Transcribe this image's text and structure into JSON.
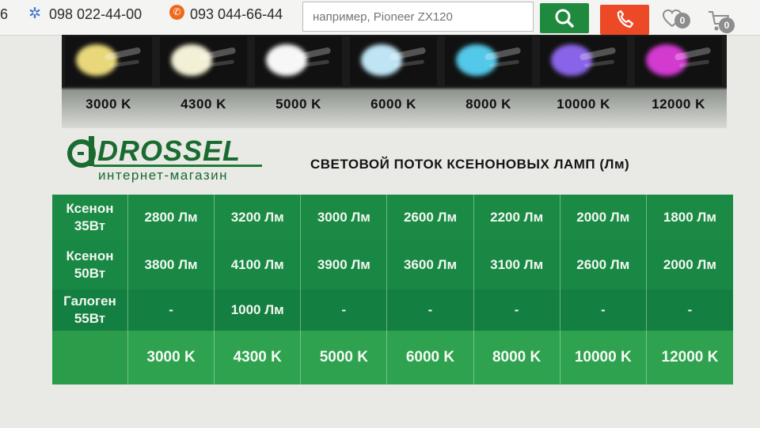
{
  "header": {
    "edge_text": "6",
    "phone_primary": "098 022-44-00",
    "phone_secondary": "093 044-66-44",
    "search_placeholder": "например, Pioneer ZX120",
    "favorites_count": "0",
    "cart_count": "0",
    "colors": {
      "search_button": "#1f8a3d",
      "call_button": "#ec4a27",
      "phone_icon": "#ee6a1b",
      "star_icon": "#3a73c8"
    },
    "icons": [
      "star-icon",
      "phone-icon",
      "search-icon",
      "phone-call-icon",
      "heart-icon",
      "cart-icon"
    ]
  },
  "lamp_samples": [
    {
      "label": "3000 K",
      "glow": "#e8d87a"
    },
    {
      "label": "4300 K",
      "glow": "#f4f0d6"
    },
    {
      "label": "5000 K",
      "glow": "#f7f7f7"
    },
    {
      "label": "6000 K",
      "glow": "#bfe4f4"
    },
    {
      "label": "8000 K",
      "glow": "#53c8e8"
    },
    {
      "label": "10000 K",
      "glow": "#8a64e8"
    },
    {
      "label": "12000 K",
      "glow": "#d33ad0"
    }
  ],
  "logo": {
    "name": "DROSSEL",
    "subtitle": "интернет-магазин",
    "color": "#1a6b30"
  },
  "heading": "СВЕТОВОЙ ПОТОК КСЕНОНОВЫХ ЛАМП (Лм)",
  "table": {
    "colors": {
      "background": "#0f7a3d",
      "text": "#f2f7f0"
    },
    "rows": [
      {
        "header_line1": "Ксенон",
        "header_line2": "35Вт",
        "values": [
          "2800 Лм",
          "3200 Лм",
          "3000 Лм",
          "2600 Лм",
          "2200 Лм",
          "2000 Лм",
          "1800 Лм"
        ]
      },
      {
        "header_line1": "Ксенон",
        "header_line2": "50Вт",
        "values": [
          "3800 Лм",
          "4100 Лм",
          "3900 Лм",
          "3600 Лм",
          "3100 Лм",
          "2600 Лм",
          "2000 Лм"
        ]
      },
      {
        "header_line1": "Галоген",
        "header_line2": "55Вт",
        "values": [
          "-",
          "1000 Лм",
          "-",
          "-",
          "-",
          "-",
          "-"
        ]
      },
      {
        "header_line1": "",
        "header_line2": "",
        "values": [
          "3000 K",
          "4300 K",
          "5000 K",
          "6000 K",
          "8000 K",
          "10000 K",
          "12000 K"
        ]
      }
    ]
  }
}
